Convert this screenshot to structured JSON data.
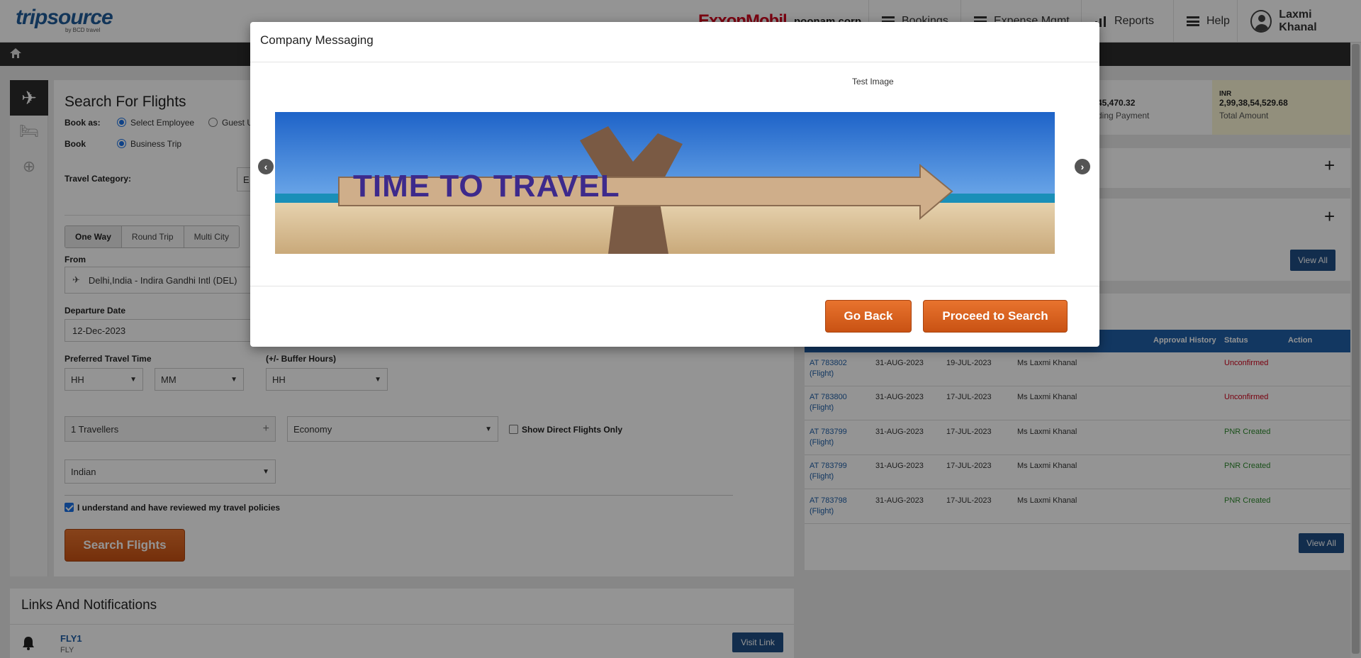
{
  "header": {
    "logo": "tripsource",
    "logo_sub": "by BCD travel",
    "brand": "ExxonMobil",
    "company": "poonam corp",
    "nav": [
      "Bookings",
      "Expense Mgmt",
      "Reports",
      "Help"
    ],
    "user": "Laxmi Khanal"
  },
  "search": {
    "title": "Search For Flights",
    "book_as_label": "Book as:",
    "book_as_options": [
      "Select Employee",
      "Guest U"
    ],
    "book_label": "Book",
    "book_option": "Business Trip",
    "travel_category_label": "Travel Category:",
    "travel_category_value": "E",
    "trip_tabs": [
      "One Way",
      "Round Trip",
      "Multi City"
    ],
    "from_label": "From",
    "from_value": "Delhi,India - Indira Gandhi Intl (DEL)",
    "departure_label": "Departure Date",
    "departure_value": "12-Dec-2023",
    "preferred_time_label": "Preferred Travel Time",
    "buffer_label": "(+/- Buffer Hours)",
    "hh": "HH",
    "mm": "MM",
    "buffer_value": "HH",
    "travellers": "1 Travellers",
    "cabin": "Economy",
    "direct_only": "Show Direct Flights Only",
    "nationality": "Indian",
    "policy_ack": "I understand and have reviewed my travel policies",
    "search_button": "Search Flights"
  },
  "links": {
    "title": "Links And Notifications",
    "item_title": "FLY1",
    "item_sub": "FLY",
    "visit_button": "Visit Link"
  },
  "summary": {
    "pending_value": "45,470.32",
    "pending_label": "ding Payment",
    "total_currency": "INR",
    "total_value": "2,99,38,54,529.68",
    "total_label": "Total Amount",
    "view_all": "View All"
  },
  "table": {
    "headers": [
      "Approval History",
      "Status",
      "Action"
    ],
    "rows": [
      {
        "id": "AT 783802",
        "type": "(Flight)",
        "d1": "31-AUG-2023",
        "d2": "19-JUL-2023",
        "name": "Ms Laxmi Khanal",
        "status": "Unconfirmed"
      },
      {
        "id": "AT 783800",
        "type": "(Flight)",
        "d1": "31-AUG-2023",
        "d2": "17-JUL-2023",
        "name": "Ms Laxmi Khanal",
        "status": "Unconfirmed"
      },
      {
        "id": "AT 783799",
        "type": "(Flight)",
        "d1": "31-AUG-2023",
        "d2": "17-JUL-2023",
        "name": "Ms Laxmi Khanal",
        "status": "PNR Created"
      },
      {
        "id": "AT 783799",
        "type": "(Flight)",
        "d1": "31-AUG-2023",
        "d2": "17-JUL-2023",
        "name": "Ms Laxmi Khanal",
        "status": "PNR Created"
      },
      {
        "id": "AT 783798",
        "type": "(Flight)",
        "d1": "31-AUG-2023",
        "d2": "17-JUL-2023",
        "name": "Ms Laxmi Khanal",
        "status": "PNR Created"
      }
    ],
    "view_all": "View All"
  },
  "modal": {
    "title": "Company Messaging",
    "caption": "Test Image",
    "banner_text": "TIME TO TRAVEL",
    "go_back": "Go Back",
    "proceed": "Proceed to Search"
  },
  "colors": {
    "accent_orange": "#e8732e",
    "brand_blue": "#1f5fa8",
    "unconfirmed": "#d0021b",
    "pnr_created": "#2e8b2e"
  }
}
